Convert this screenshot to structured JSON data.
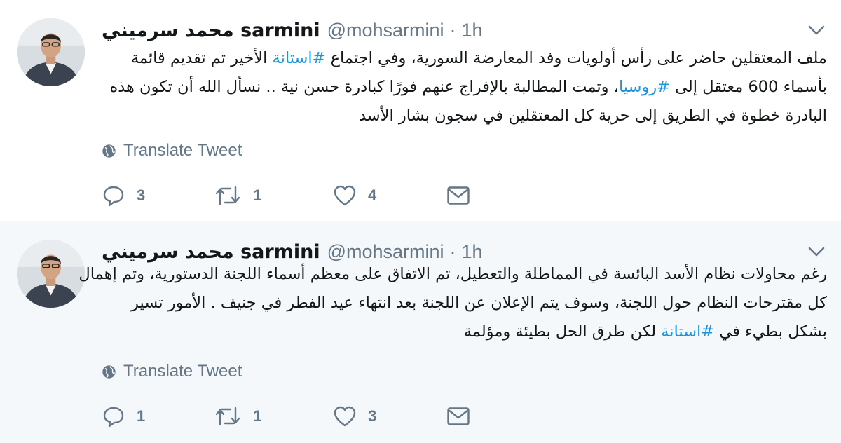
{
  "tweets": [
    {
      "display_name": "محمد سرميني sarmini",
      "handle": "@mohsarmini",
      "separator": "·",
      "time": "1h",
      "lines": [
        [
          {
            "text": "ملف المعتقلين حاضر  على رأس أولويات وفد المعارضة السورية، وفي اجتماع ",
            "hashtag": false
          },
          {
            "text": "#استانة",
            "hashtag": true
          },
          {
            "text": " الأخير تم تقديم قائمة",
            "hashtag": false
          }
        ],
        [
          {
            "text": "بأسماء 600 معتقل إلى ",
            "hashtag": false
          },
          {
            "text": "#روسيا",
            "hashtag": true
          },
          {
            "text": "، وتمت المطالبة بالإفراج عنهم فورًا كبادرة حسن نية .. نسأل الله أن تكون هذه",
            "hashtag": false
          }
        ],
        [
          {
            "text": "البادرة خطوة في الطريق إلى حرية كل المعتقلين في سجون بشار الأسد",
            "hashtag": false
          }
        ]
      ],
      "translate_label": "Translate Tweet",
      "actions": {
        "reply": "3",
        "retweet": "1",
        "like": "4",
        "dm": ""
      }
    },
    {
      "display_name": "محمد سرميني sarmini",
      "handle": "@mohsarmini",
      "separator": "·",
      "time": "1h",
      "lines": [
        [
          {
            "text": "رغم محاولات نظام الأسد البائسة في المماطلة والتعطيل، تم الاتفاق على معظم  أسماء اللجنة الدستورية، وتم إهمال",
            "hashtag": false
          }
        ],
        [
          {
            "text": "كل مقترحات النظام حول اللجنة، وسوف يتم الإعلان عن اللجنة بعد انتهاء عيد الفطر في جنيف . الأمور تسير",
            "hashtag": false
          }
        ],
        [
          {
            "text": "بشكل بطيء في ",
            "hashtag": false
          },
          {
            "text": "#استانة",
            "hashtag": true
          },
          {
            "text": " لكن طرق الحل بطيئة ومؤلمة",
            "hashtag": false
          }
        ]
      ],
      "translate_label": "Translate Tweet",
      "actions": {
        "reply": "1",
        "retweet": "1",
        "like": "3",
        "dm": ""
      }
    }
  ],
  "colors": {
    "accent": "#1b95e0",
    "muted": "#657786",
    "text": "#14171a",
    "alt_bg": "#f5f8fa",
    "border": "#e1e8ed"
  },
  "icons": {
    "reply": "reply-icon",
    "retweet": "retweet-icon",
    "like": "heart-icon",
    "dm": "envelope-icon",
    "translate": "globe-icon",
    "caret": "chevron-down-icon"
  }
}
